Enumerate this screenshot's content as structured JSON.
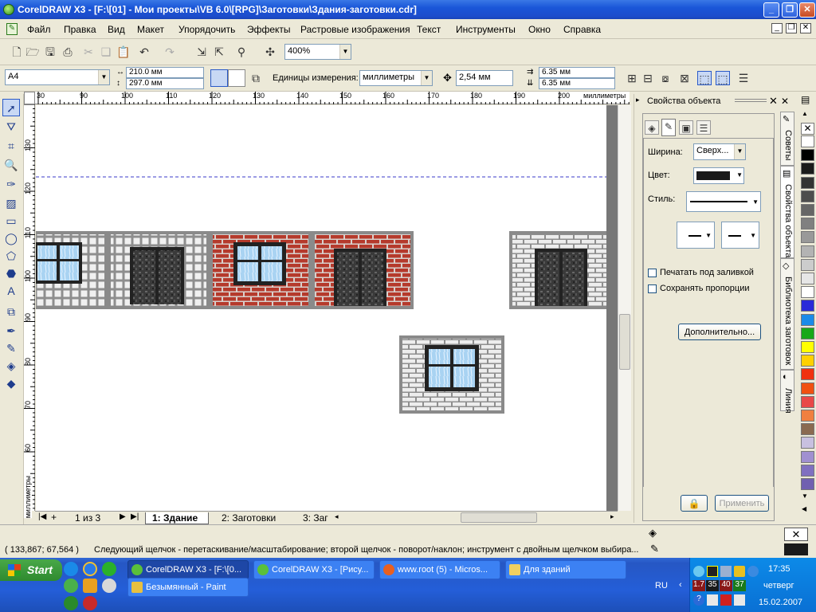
{
  "window": {
    "title": "CorelDRAW X3 - [F:\\[01] - Мои проекты\\VB 6.0\\[RPG]\\Заготовки\\Здания-заготовки.cdr]"
  },
  "menu": [
    {
      "label": "Файл"
    },
    {
      "label": "Правка"
    },
    {
      "label": "Вид"
    },
    {
      "label": "Макет"
    },
    {
      "label": "Упорядочить"
    },
    {
      "label": "Эффекты"
    },
    {
      "label": "Растровые изображения"
    },
    {
      "label": "Текст"
    },
    {
      "label": "Инструменты"
    },
    {
      "label": "Окно"
    },
    {
      "label": "Справка"
    }
  ],
  "toolbar": {
    "zoom": "400%"
  },
  "propbar": {
    "page_size": "A4",
    "width": "210.0 мм",
    "height": "297.0 мм",
    "units_label": "Единицы измерения:",
    "units": "миллиметры",
    "nudge": "2,54 мм",
    "dup_x": "6.35 мм",
    "dup_y": "6.35 мм"
  },
  "ruler": {
    "h_ticks": [
      "30",
      "90",
      "100",
      "110",
      "120",
      "130",
      "140",
      "150",
      "160",
      "170",
      "180",
      "190",
      "200"
    ],
    "h_unit": "миллиметры",
    "v_ticks": [
      "130",
      "120",
      "110",
      "100",
      "90",
      "80",
      "70",
      "60"
    ],
    "v_unit": "миллиметры"
  },
  "colors": {
    "brick_red": "#b33a2a",
    "brick_gray": "#e8e8e8",
    "frame": "#8a8a8a",
    "glass": "#a8d4f4",
    "dark": "#3a3a3a",
    "guide": "#3a3ac8"
  },
  "page_nav": {
    "counter": "1 из 3",
    "tabs": [
      {
        "label": "1: Здание"
      },
      {
        "label": "2: Заготовки"
      },
      {
        "label": "3: Заг"
      }
    ]
  },
  "docker": {
    "title": "Свойства объекта",
    "width_label": "Ширина:",
    "width_value": "Сверх...",
    "color_label": "Цвет:",
    "style_label": "Стиль:",
    "chk_behind": "Печатать под заливкой",
    "chk_scale": "Сохранять пропорции",
    "more_button": "Дополнительно...",
    "apply_button": "Применить"
  },
  "vtabs": [
    {
      "label": "Советы"
    },
    {
      "label": "Свойства объекта"
    },
    {
      "label": "Библиотека заготовок"
    },
    {
      "label": "Линия"
    }
  ],
  "palette": [
    "#ffffff",
    "#000000",
    "#1a1a1a",
    "#333333",
    "#4d4d4d",
    "#666666",
    "#808080",
    "#999999",
    "#b3b3b3",
    "#cccccc",
    "#e6e6e6",
    "#ffffff",
    "#2a2ad8",
    "#1a8ae8",
    "#18a818",
    "#ffff00",
    "#ffd000",
    "#f03010",
    "#f05010",
    "#e84848",
    "#f08040",
    "#8a6a50",
    "#c8c0e0",
    "#a090d0",
    "#8070c0",
    "#7060b0"
  ],
  "status": {
    "coords": "( 133,867; 67,564 )",
    "hint": "Следующий щелчок - перетаскивание/масштабирование; второй щелчок - поворот/наклон; инструмент с двойным щелчком выбира..."
  },
  "taskbar": {
    "start": "Start",
    "tasks": [
      {
        "label": "CorelDRAW X3 - [F:\\[0..."
      },
      {
        "label": "CorelDRAW X3 - [Рису..."
      },
      {
        "label": "www.root (5) - Micros..."
      },
      {
        "label": "Для зданий"
      },
      {
        "label": "Безымянный - Paint"
      }
    ],
    "lang": "RU",
    "tray_nums": [
      "1.7",
      "35",
      "40",
      "37"
    ],
    "time": "17:35",
    "day": "четверг",
    "date": "15.02.2007"
  }
}
